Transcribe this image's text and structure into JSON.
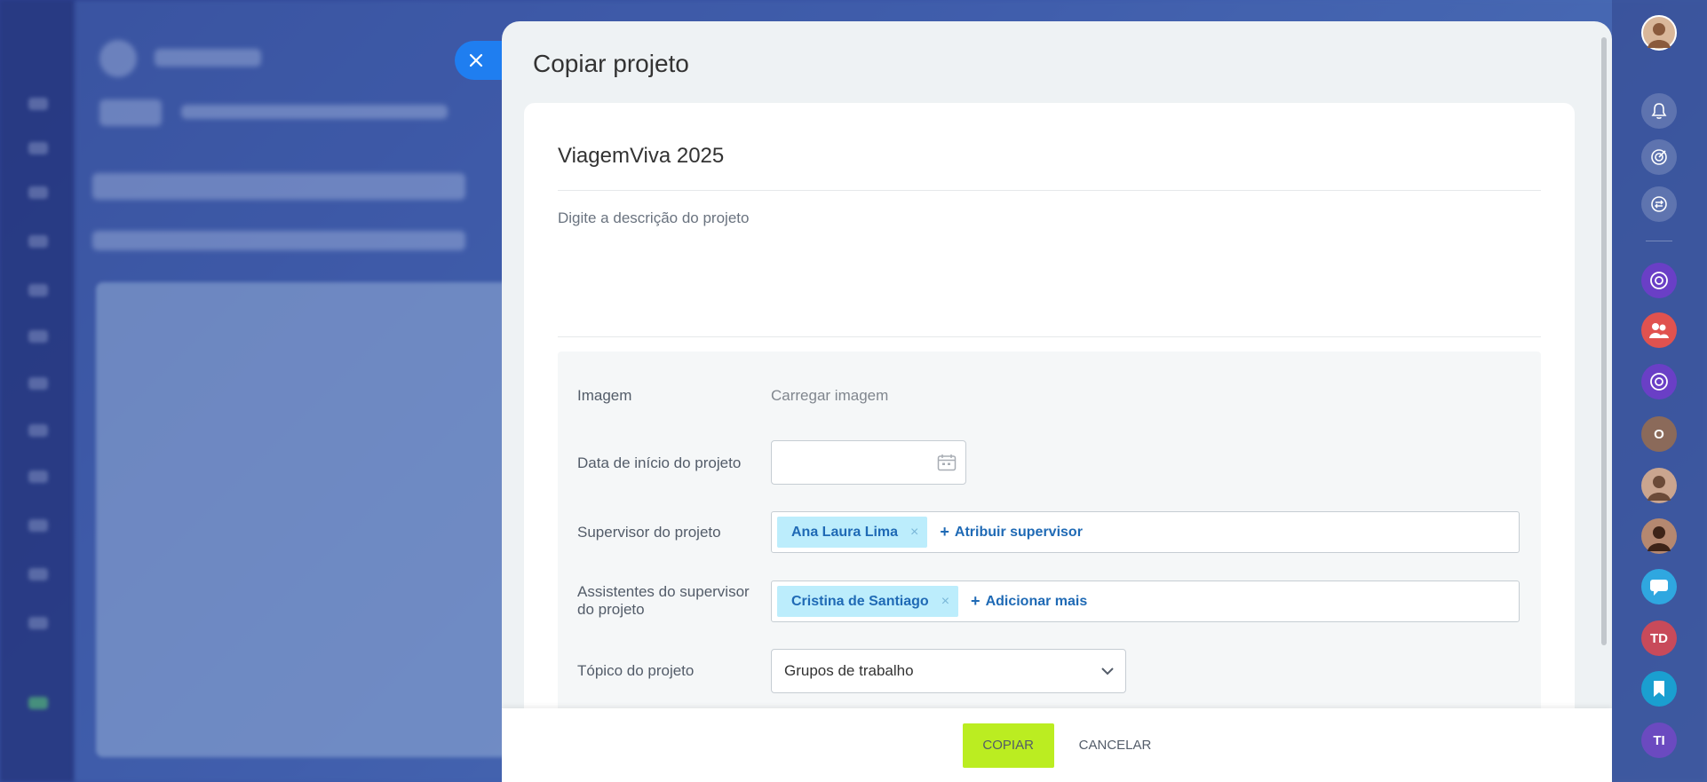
{
  "slider": {
    "title": "Copiar projeto",
    "project_name": "ViagemViva 2025",
    "description_placeholder": "Digite a descrição do projeto",
    "fields": {
      "image_label": "Imagem",
      "image_action": "Carregar imagem",
      "start_date_label": "Data de início do projeto",
      "start_date_value": "",
      "supervisor_label": "Supervisor do projeto",
      "supervisor_tag": "Ana Laura Lima",
      "supervisor_add": "Atribuir supervisor",
      "assistants_label": "Assistentes do supervisor do projeto",
      "assistants_tag": "Cristina de Santiago",
      "assistants_add": "Adicionar mais",
      "topic_label": "Tópico do projeto",
      "topic_value": "Grupos de trabalho"
    },
    "footer": {
      "copy_label": "COPIAR",
      "cancel_label": "CANCELAR"
    }
  },
  "right_rail": {
    "items": [
      {
        "icon": "user-avatar"
      },
      {
        "icon": "bell-icon"
      },
      {
        "icon": "target-icon"
      },
      {
        "icon": "sync-icon"
      },
      {
        "icon": "copilot-icon"
      },
      {
        "icon": "group-icon"
      },
      {
        "icon": "copilot-icon"
      },
      {
        "initials": "O"
      },
      {
        "icon": "user-avatar"
      },
      {
        "icon": "user-avatar"
      },
      {
        "icon": "chat-icon"
      },
      {
        "initials": "TD"
      },
      {
        "icon": "bookmark-icon"
      },
      {
        "initials": "TI"
      }
    ]
  },
  "colors": {
    "accent": "#1f7ef0",
    "copy_button": "#bbed21",
    "tag_bg": "#bcedfc",
    "link": "#1f6ab5"
  }
}
